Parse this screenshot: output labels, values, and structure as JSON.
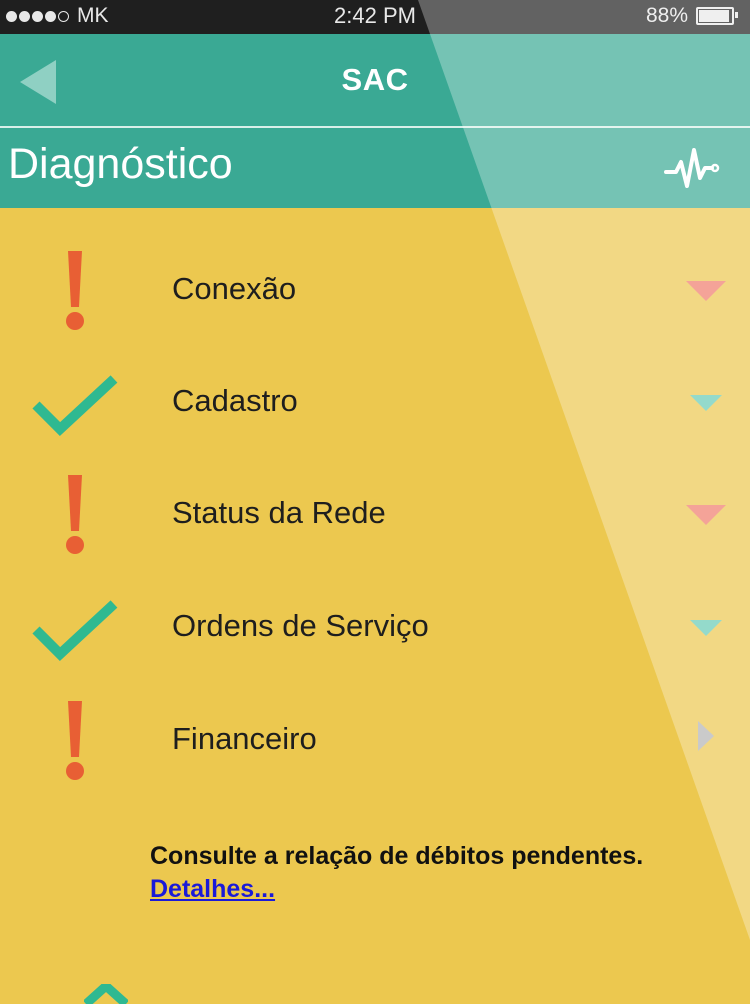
{
  "status_bar": {
    "carrier": "MK",
    "time": "2:42 PM",
    "battery": "88%",
    "battery_level": 0.88,
    "signal_bars_filled": 4,
    "signal_bars_total": 5
  },
  "nav": {
    "title": "SAC",
    "back_icon": "back-arrow-icon"
  },
  "section": {
    "title": "Diagnóstico",
    "icon": "pulse-icon"
  },
  "items": [
    {
      "label": "Conexão",
      "status": "warning",
      "expand": "collapsed",
      "chevron": "triangle-down-red"
    },
    {
      "label": "Cadastro",
      "status": "ok",
      "expand": "collapsed",
      "chevron": "triangle-down-teal"
    },
    {
      "label": "Status da Rede",
      "status": "warning",
      "expand": "collapsed",
      "chevron": "triangle-down-red"
    },
    {
      "label": "Ordens de Serviço",
      "status": "ok",
      "expand": "collapsed",
      "chevron": "triangle-down-teal"
    },
    {
      "label": "Financeiro",
      "status": "warning",
      "expand": "expanded",
      "chevron": "triangle-right-gray"
    }
  ],
  "financeiro_detail": {
    "message": "Consulte a relação de débitos pendentes.",
    "link": "Detalhes..."
  },
  "colors": {
    "teal": "#3aa994",
    "yellow": "#ecc84f",
    "warning": "#e85f34",
    "check": "#2fb991",
    "chevron_red": "#ef7b6c",
    "chevron_teal": "#66cbb5",
    "chevron_gray": "#b4b4b4"
  }
}
